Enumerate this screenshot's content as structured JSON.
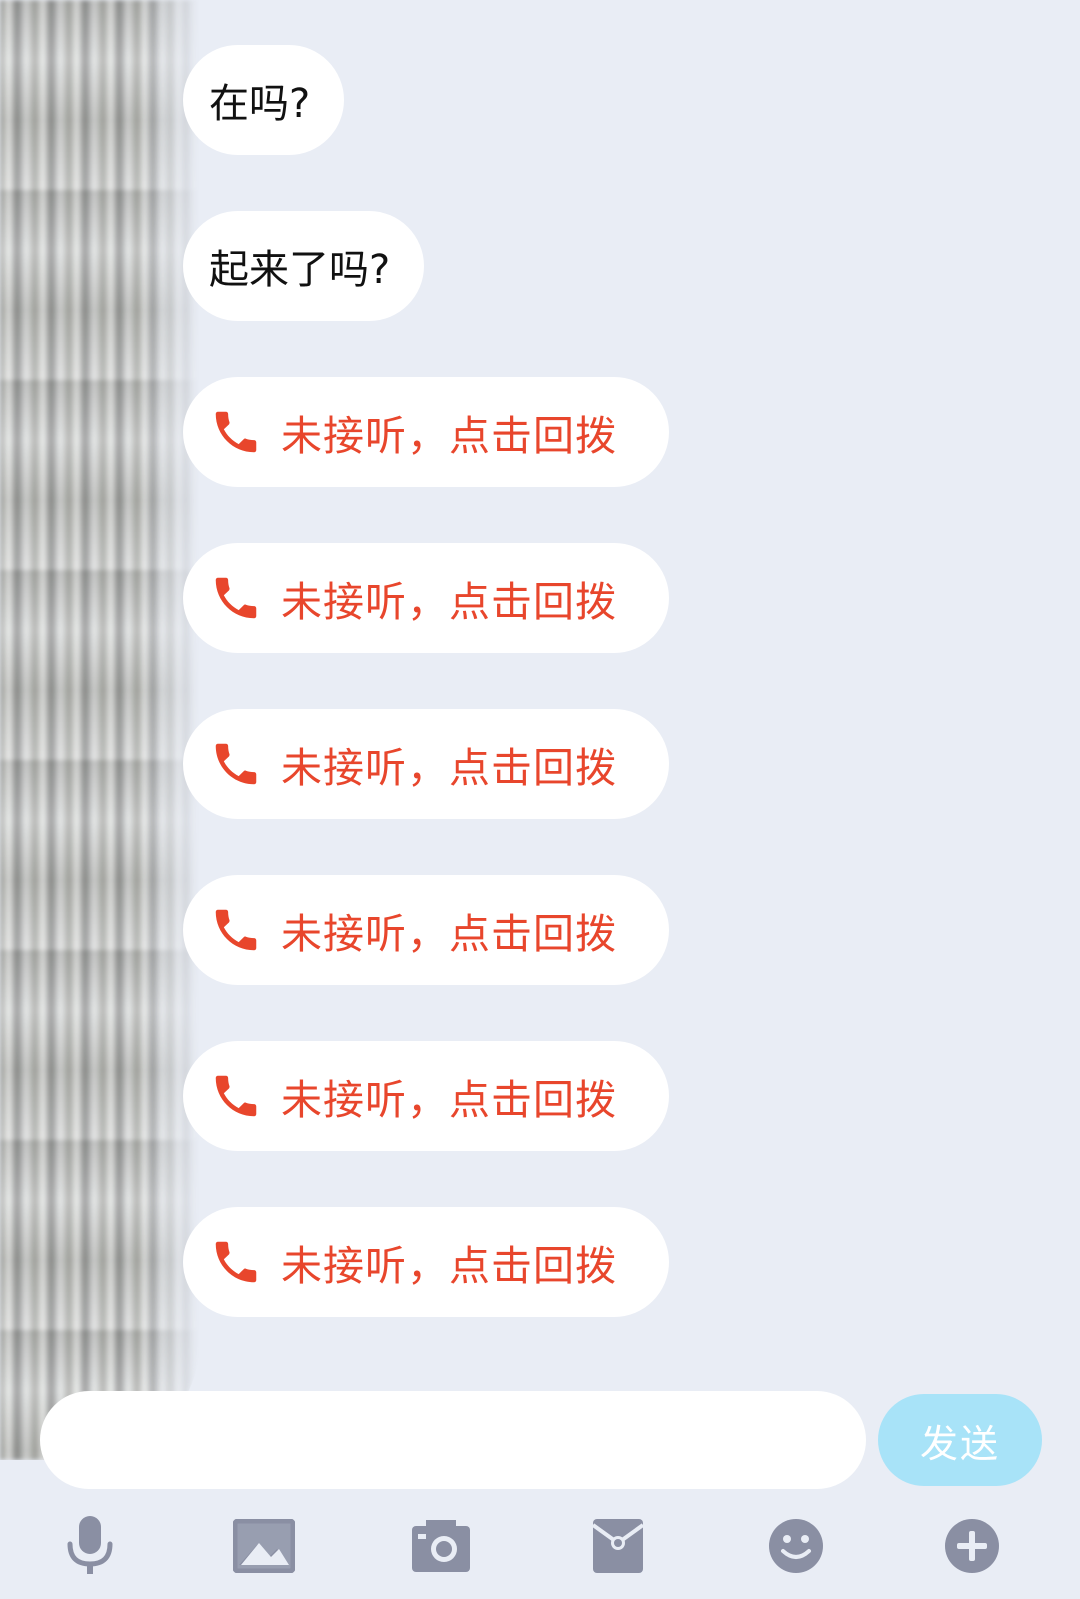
{
  "messages": [
    {
      "type": "text",
      "text": "在吗?"
    },
    {
      "type": "text",
      "text": "起来了吗?"
    },
    {
      "type": "missed_call",
      "text": "未接听，点击回拨"
    },
    {
      "type": "missed_call",
      "text": "未接听，点击回拨"
    },
    {
      "type": "missed_call",
      "text": "未接听，点击回拨"
    },
    {
      "type": "missed_call",
      "text": "未接听，点击回拨"
    },
    {
      "type": "missed_call",
      "text": "未接听，点击回拨"
    },
    {
      "type": "missed_call",
      "text": "未接听，点击回拨"
    }
  ],
  "input": {
    "value": "",
    "placeholder": ""
  },
  "send_label": "发送",
  "toolbar": {
    "icons": [
      "microphone-icon",
      "image-icon",
      "camera-icon",
      "red-packet-icon",
      "emoji-icon",
      "plus-icon"
    ]
  },
  "colors": {
    "background": "#e9edf5",
    "bubble": "#ffffff",
    "missed_call": "#e8462c",
    "send_button": "#a8e3f8",
    "toolbar_icon": "#8a8fa3"
  }
}
